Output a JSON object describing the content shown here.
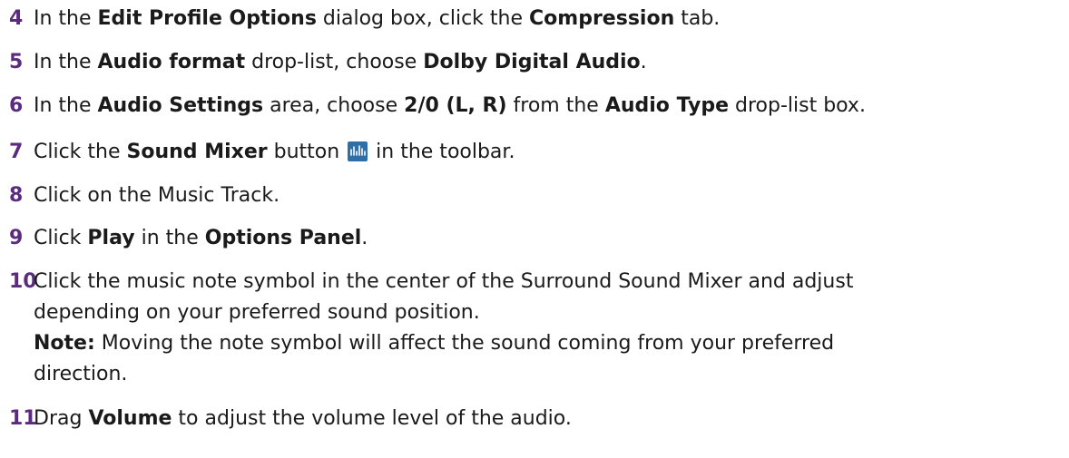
{
  "steps": [
    {
      "num": "4",
      "t1": "In the ",
      "b1": "Edit Profile Options",
      "t2": " dialog box, click the ",
      "b2": "Compression",
      "t3": " tab."
    },
    {
      "num": "5",
      "t1": "In the ",
      "b1": "Audio format",
      "t2": " drop-list, choose ",
      "b2": "Dolby Digital Audio",
      "t3": "."
    },
    {
      "num": "6",
      "t1": "In the ",
      "b1": "Audio Settings",
      "t2": " area, choose ",
      "b2": "2/0 (L, R)",
      "t3": " from the ",
      "b3": "Audio Type",
      "t4": " drop-list box."
    },
    {
      "num": "7",
      "t1": "Click the ",
      "b1": "Sound Mixer",
      "t2": " button ",
      "t3": " in the toolbar."
    },
    {
      "num": "8",
      "t1": "Click on the Music Track."
    },
    {
      "num": "9",
      "t1": "Click ",
      "b1": "Play",
      "t2": " in the ",
      "b2": "Options Panel",
      "t3": "."
    },
    {
      "num": "10",
      "t1": "Click the music note symbol in the center of the Surround Sound Mixer and adjust",
      "t2": "depending on your preferred sound position.",
      "note_label": "Note:",
      "note_text": "  Moving the note symbol will affect the sound coming from your preferred",
      "note_text2": "direction."
    },
    {
      "num": "11",
      "t1": "Drag ",
      "b1": "Volume",
      "t2": " to adjust the volume level of the audio."
    }
  ],
  "icons": {
    "sound_mixer": "sound-mixer-icon"
  },
  "colors": {
    "step_number": "#5b2b7f",
    "icon_bg": "#2f6fa8"
  }
}
